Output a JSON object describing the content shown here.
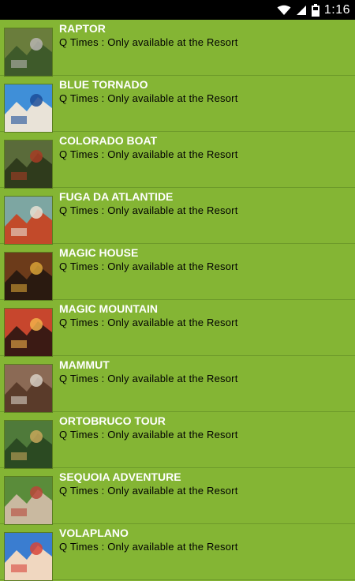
{
  "status_bar": {
    "time": "1:16",
    "icons": [
      "wifi-icon",
      "signal-icon",
      "battery-icon"
    ]
  },
  "rides": [
    {
      "name": "RAPTOR",
      "subtitle": "Q Times : Only available at the Resort",
      "thumb_colors": [
        "#6a7d3c",
        "#b7b4b0",
        "#3e5a2a"
      ]
    },
    {
      "name": "BLUE TORNADO",
      "subtitle": "Q Times : Only available at the Resort",
      "thumb_colors": [
        "#3f8fd8",
        "#1c4e9a",
        "#e9e3d8"
      ]
    },
    {
      "name": "COLORADO BOAT",
      "subtitle": "Q Times : Only available at the Resort",
      "thumb_colors": [
        "#5a6b3a",
        "#a63c24",
        "#2f3b1c"
      ]
    },
    {
      "name": "FUGA DA ATLANTIDE",
      "subtitle": "Q Times : Only available at the Resort",
      "thumb_colors": [
        "#7da6a2",
        "#e6e0d4",
        "#c24a2a"
      ]
    },
    {
      "name": "MAGIC HOUSE",
      "subtitle": "Q Times : Only available at the Resort",
      "thumb_colors": [
        "#6c3b1a",
        "#d8a236",
        "#2a1a10"
      ]
    },
    {
      "name": "MAGIC MOUNTAIN",
      "subtitle": "Q Times : Only available at the Resort",
      "thumb_colors": [
        "#c7462d",
        "#f2b04a",
        "#3b1a14"
      ]
    },
    {
      "name": "MAMMUT",
      "subtitle": "Q Times : Only available at the Resort",
      "thumb_colors": [
        "#8b6a55",
        "#d7cfc4",
        "#5a3b2a"
      ]
    },
    {
      "name": "ORTOBRUCO TOUR",
      "subtitle": "Q Times : Only available at the Resort",
      "thumb_colors": [
        "#4f7a3a",
        "#c7a75b",
        "#2b4a22"
      ]
    },
    {
      "name": "SEQUOIA ADVENTURE",
      "subtitle": "Q Times : Only available at the Resort",
      "thumb_colors": [
        "#5a8c3a",
        "#b8473a",
        "#c9b9a0"
      ]
    },
    {
      "name": "VOLAPLANO",
      "subtitle": "Q Times : Only available at the Resort",
      "thumb_colors": [
        "#3a7dd0",
        "#d7453a",
        "#f0d7c0"
      ]
    }
  ]
}
